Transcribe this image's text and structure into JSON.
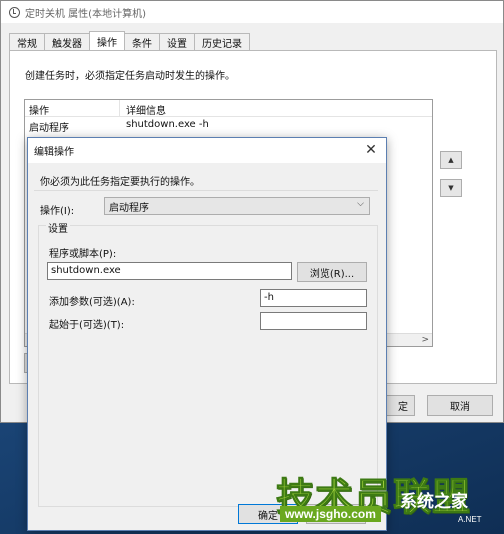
{
  "outer_window": {
    "title": "定时关机 属性(本地计算机)",
    "tabs": [
      "常规",
      "触发器",
      "操作",
      "条件",
      "设置",
      "历史记录"
    ],
    "active_tab_index": 2,
    "description": "创建任务时，必须指定任务启动时发生的操作。",
    "grid": {
      "headers": [
        "操作",
        "详细信息"
      ],
      "rows": [
        {
          "action": "启动程序",
          "details": "shutdown.exe -h"
        }
      ]
    },
    "move_up_icon": "triangle-up",
    "move_down_icon": "triangle-down",
    "ok_label_partial": "定",
    "cancel_label": "取消"
  },
  "dialog": {
    "title": "编辑操作",
    "description": "你必须为此任务指定要执行的操作。",
    "action_label": "操作(I):",
    "action_value": "启动程序",
    "settings_title": "设置",
    "program_label": "程序或脚本(P):",
    "program_value": "shutdown.exe",
    "browse_label": "浏览(R)...",
    "args_label": "添加参数(可选)(A):",
    "args_value": "-h",
    "start_in_label": "起始于(可选)(T):",
    "start_in_value": "",
    "ok_label": "确定"
  },
  "watermark": {
    "brand_cn": "技术员联盟",
    "url": "www.jsgho.com",
    "right_cn": "系统之家",
    "right_net": "A.NET"
  }
}
